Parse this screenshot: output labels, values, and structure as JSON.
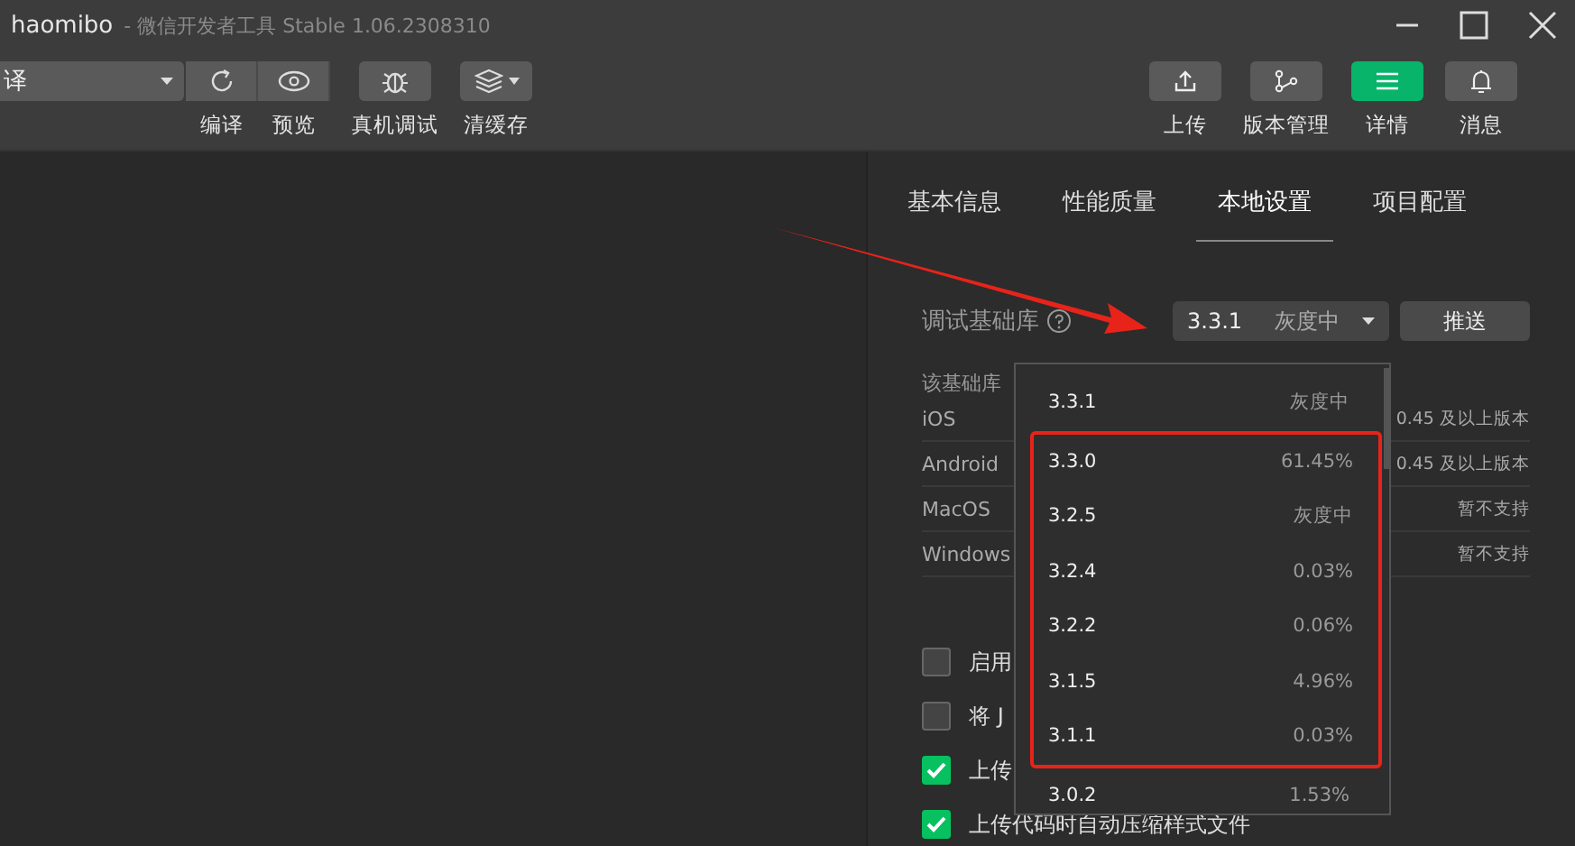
{
  "window": {
    "title_name": "haomibo",
    "title_app": "- 微信开发者工具 Stable 1.06.2308310"
  },
  "toolbar_left": {
    "compile_mode": "译",
    "buttons": [
      {
        "label": "编译",
        "kind": "refresh"
      },
      {
        "label": "预览",
        "kind": "eye"
      },
      {
        "label": "真机调试",
        "kind": "bug"
      },
      {
        "label": "清缓存",
        "kind": "layers"
      }
    ]
  },
  "toolbar_right": {
    "buttons": [
      {
        "label": "上传",
        "kind": "upload",
        "selected": false
      },
      {
        "label": "版本管理",
        "kind": "branch",
        "selected": false
      },
      {
        "label": "详情",
        "kind": "menu",
        "selected": true
      },
      {
        "label": "消息",
        "kind": "bell",
        "selected": false
      }
    ]
  },
  "tabs": [
    {
      "label": "基本信息",
      "selected": false
    },
    {
      "label": "性能质量",
      "selected": false
    },
    {
      "label": "本地设置",
      "selected": true
    },
    {
      "label": "项目配置",
      "selected": false
    }
  ],
  "base_library": {
    "label": "调试基础库",
    "version": "3.3.1",
    "status": "灰度中",
    "push_button": "推送"
  },
  "support": {
    "heading": "该基础库",
    "rows": [
      {
        "platform": "iOS",
        "value": "0.45 及以上版本"
      },
      {
        "platform": "Android",
        "value": "0.45 及以上版本"
      },
      {
        "platform": "MacOS",
        "value": "暂不支持"
      },
      {
        "platform": "Windows",
        "value": "暂不支持"
      }
    ]
  },
  "options": [
    {
      "label": "启用",
      "checked": false
    },
    {
      "label": "将 J",
      "checked": false
    },
    {
      "label": "上传",
      "checked": true
    },
    {
      "label": "上传代码时自动压缩样式文件",
      "checked": true
    }
  ],
  "dropdown": {
    "items": [
      {
        "version": "3.3.1",
        "info": "灰度中",
        "highlighted": false
      },
      {
        "version": "3.3.0",
        "info": "61.45%",
        "highlighted": true
      },
      {
        "version": "3.2.5",
        "info": "灰度中",
        "highlighted": true
      },
      {
        "version": "3.2.4",
        "info": "0.03%",
        "highlighted": true
      },
      {
        "version": "3.2.2",
        "info": "0.06%",
        "highlighted": true
      },
      {
        "version": "3.1.5",
        "info": "4.96%",
        "highlighted": true
      },
      {
        "version": "3.1.1",
        "info": "0.03%",
        "highlighted": true
      },
      {
        "version": "3.0.2",
        "info": "1.53%",
        "highlighted": false
      }
    ]
  }
}
